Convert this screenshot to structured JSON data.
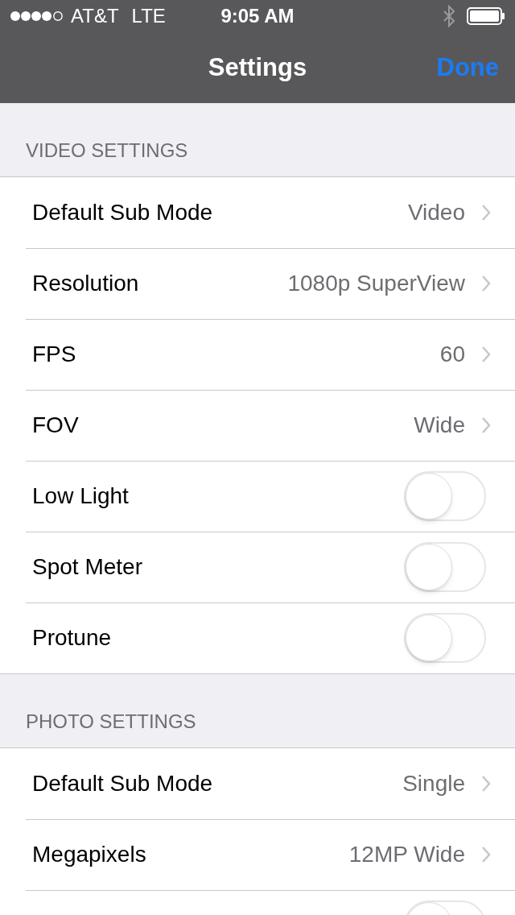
{
  "status_bar": {
    "carrier": "AT&T",
    "network": "LTE",
    "time": "9:05 AM"
  },
  "nav_bar": {
    "title": "Settings",
    "done": "Done"
  },
  "sections": [
    {
      "header": "VIDEO SETTINGS",
      "rows": [
        {
          "kind": "detail",
          "label": "Default Sub Mode",
          "value": "Video"
        },
        {
          "kind": "detail",
          "label": "Resolution",
          "value": "1080p SuperView"
        },
        {
          "kind": "detail",
          "label": "FPS",
          "value": "60"
        },
        {
          "kind": "detail",
          "label": "FOV",
          "value": "Wide"
        },
        {
          "kind": "toggle",
          "label": "Low Light",
          "on": false
        },
        {
          "kind": "toggle",
          "label": "Spot Meter",
          "on": false
        },
        {
          "kind": "toggle",
          "label": "Protune",
          "on": false
        }
      ]
    },
    {
      "header": "PHOTO SETTINGS",
      "rows": [
        {
          "kind": "detail",
          "label": "Default Sub Mode",
          "value": "Single"
        },
        {
          "kind": "detail",
          "label": "Megapixels",
          "value": "12MP Wide"
        },
        {
          "kind": "toggle",
          "on": false
        }
      ]
    }
  ]
}
